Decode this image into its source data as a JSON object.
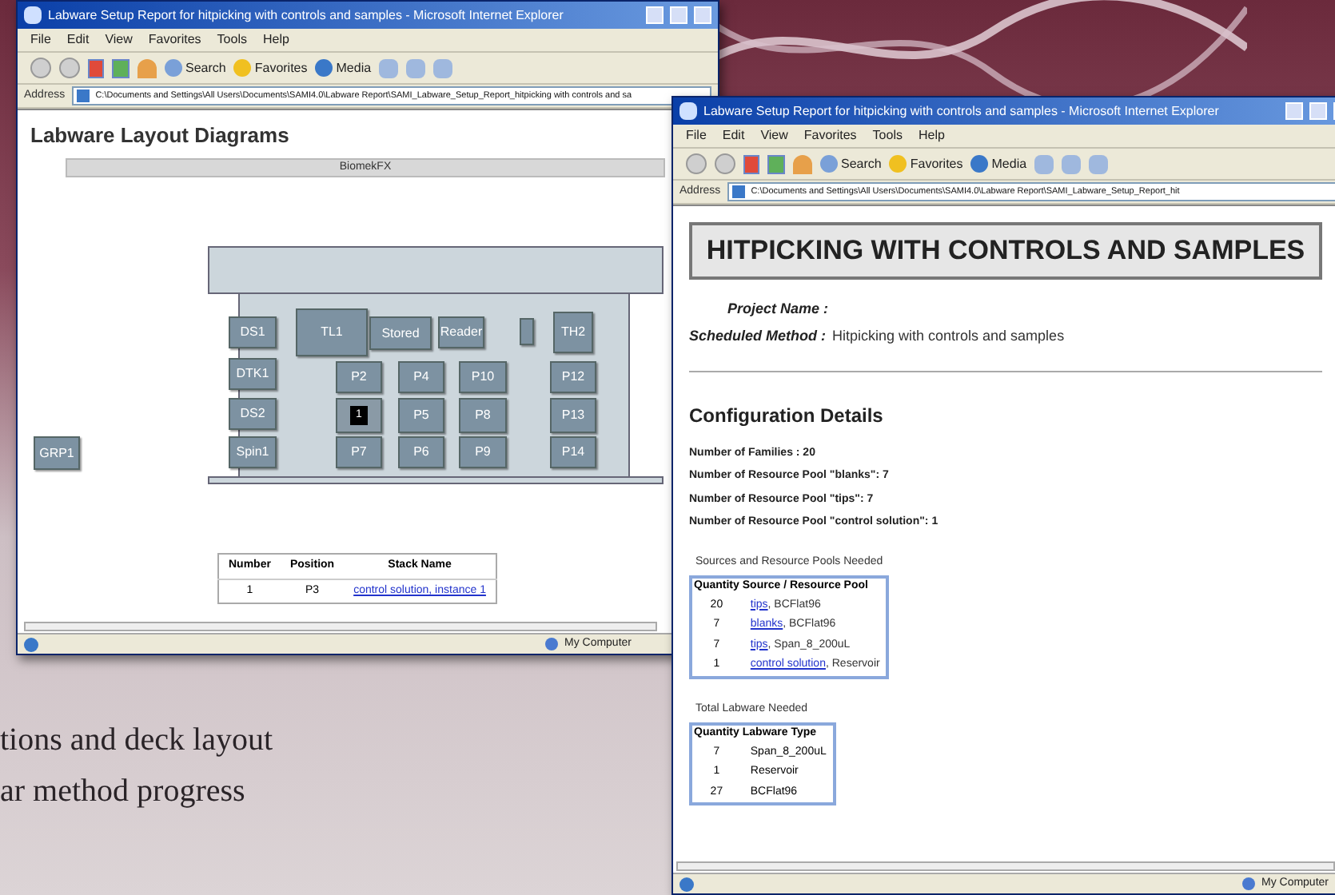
{
  "background": {
    "caption_lines": [
      "tions and deck layout",
      "ar method progress"
    ]
  },
  "windows": [
    {
      "title": "Labware Setup Report for hitpicking with controls and samples - Microsoft Internet Explorer",
      "menu": [
        "File",
        "Edit",
        "View",
        "Favorites",
        "Tools",
        "Help"
      ],
      "toolbar": [
        "Search",
        "Favorites",
        "Media"
      ],
      "address_label": "Address",
      "address": "C:\\Documents and Settings\\All Users\\Documents\\SAMI4.0\\Labware Report\\SAMI_Labware_Setup_Report_hitpicking with controls and sa",
      "status": "My Computer",
      "page": {
        "kind": "layout",
        "heading": "Labware Layout Diagrams",
        "deck_name": "BiomekFX",
        "slots": [
          {
            "label": "GRP1",
            "kind": "plate"
          },
          {
            "label": "DS1",
            "kind": "plate"
          },
          {
            "label": "DTK1",
            "kind": "plate"
          },
          {
            "label": "DS2",
            "kind": "plate"
          },
          {
            "label": "Spin1",
            "kind": "plate"
          },
          {
            "label": "TL1",
            "kind": "plate"
          },
          {
            "label": "Stored",
            "kind": "plate"
          },
          {
            "label": "Reader",
            "kind": "plate"
          },
          {
            "kind": "small"
          },
          {
            "label": "TH2",
            "kind": "plate"
          },
          {
            "label": "P2",
            "kind": "plate"
          },
          {
            "label": "P4",
            "kind": "plate"
          },
          {
            "label": "P10",
            "kind": "plate"
          },
          {
            "label": "P12",
            "kind": "plate"
          },
          {
            "label": "1",
            "kind": "stack"
          },
          {
            "label": "P5",
            "kind": "plate"
          },
          {
            "label": "P8",
            "kind": "plate"
          },
          {
            "label": "P13",
            "kind": "plate"
          },
          {
            "label": "P7",
            "kind": "plate"
          },
          {
            "label": "P6",
            "kind": "plate"
          },
          {
            "label": "P9",
            "kind": "plate"
          },
          {
            "label": "P14",
            "kind": "plate"
          }
        ],
        "table": {
          "columns": [
            "Number",
            "Position",
            "Stack Name"
          ],
          "rows": [
            [
              "1",
              "P3",
              "control solution, instance 1"
            ]
          ]
        }
      }
    },
    {
      "title": "Labware Setup Report for hitpicking with controls and samples - Microsoft Internet Explorer",
      "menu": [
        "File",
        "Edit",
        "View",
        "Favorites",
        "Tools",
        "Help"
      ],
      "toolbar": [
        "Search",
        "Favorites",
        "Media"
      ],
      "address_label": "Address",
      "address": "C:\\Documents and Settings\\All Users\\Documents\\SAMI4.0\\Labware Report\\SAMI_Labware_Setup_Report_hit",
      "status": "My Computer",
      "page": {
        "kind": "report",
        "title": "HITPICKING WITH CONTROLS AND SAMPLES",
        "fields": [
          {
            "label": "Project Name :"
          },
          {
            "label": "Scheduled Method :",
            "value": "Hitpicking with controls and samples"
          }
        ],
        "section": "Configuration Details",
        "stats": [
          "Number of Families : 20",
          "Number of Resource Pool \"blanks\": 7",
          "Number of Resource Pool \"tips\": 7",
          "Number of Resource Pool \"control solution\": 1"
        ],
        "tables": [
          {
            "caption": "Sources and Resource Pools Needed",
            "columns": [
              "Quantity",
              "Source / Resource Pool"
            ],
            "rows": [
              {
                "qty": "20",
                "link": "tips",
                "rest": ", BCFlat96"
              },
              {
                "qty": "7",
                "link": "blanks",
                "rest": ", BCFlat96"
              },
              {
                "qty": "7",
                "link": "tips",
                "rest": ", Span_8_200uL"
              },
              {
                "qty": "1",
                "link": "control solution",
                "rest": ", Reservoir"
              }
            ]
          },
          {
            "caption": "Total Labware Needed",
            "columns": [
              "Quantity",
              "Labware Type"
            ],
            "rows": [
              {
                "qty": "7",
                "rest": "Span_8_200uL"
              },
              {
                "qty": "1",
                "rest": "Reservoir"
              },
              {
                "qty": "27",
                "rest": "BCFlat96"
              }
            ]
          }
        ]
      }
    }
  ]
}
